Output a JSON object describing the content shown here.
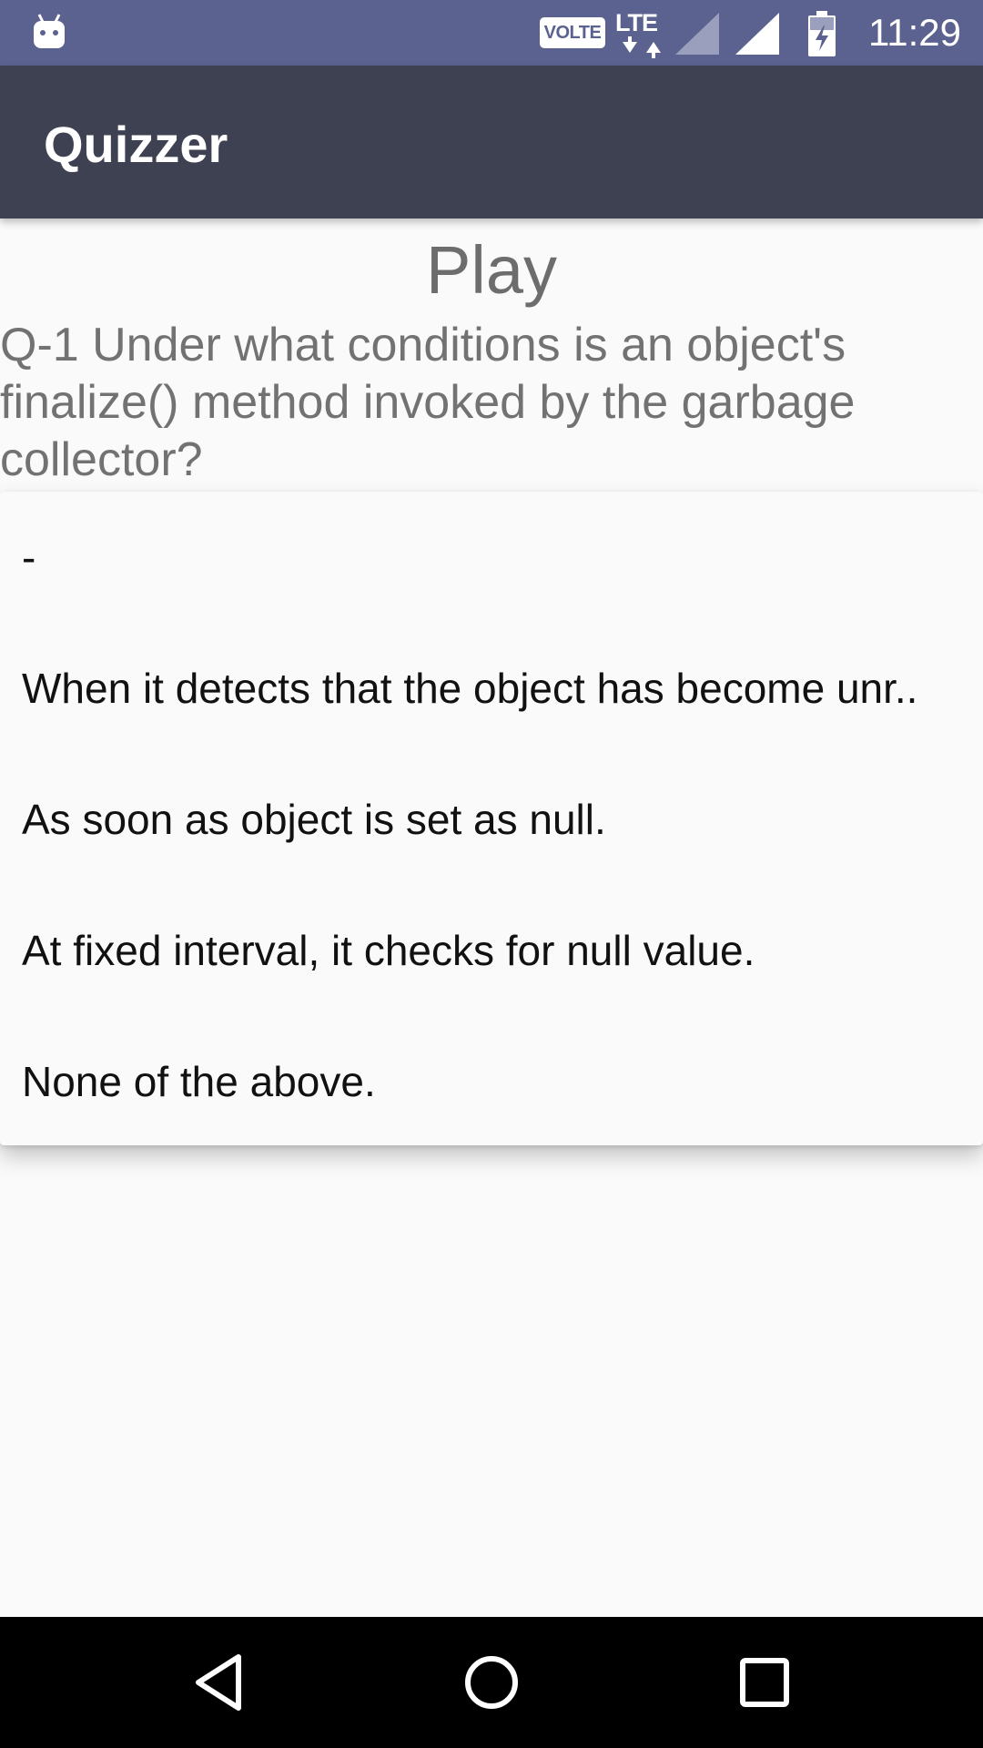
{
  "status_bar": {
    "time": "11:29",
    "volte_label": "VOLTE",
    "network_label": "LTE"
  },
  "app_bar": {
    "title": "Quizzer"
  },
  "page": {
    "title": "Play",
    "question": "Q-1 Under what conditions is an object's finalize() method invoked by the garbage collector?"
  },
  "options_menu": {
    "items": [
      "-",
      "When it detects that the object has become unr..",
      "As soon as object is set as null.",
      "At fixed interval, it checks for null value.",
      "None of the above."
    ]
  },
  "nav_bar": {
    "icons": [
      "back-icon",
      "home-icon",
      "recents-icon"
    ]
  },
  "colors": {
    "status_bar": "#5c628f",
    "app_bar": "#3e4152",
    "background": "#fafafa"
  }
}
